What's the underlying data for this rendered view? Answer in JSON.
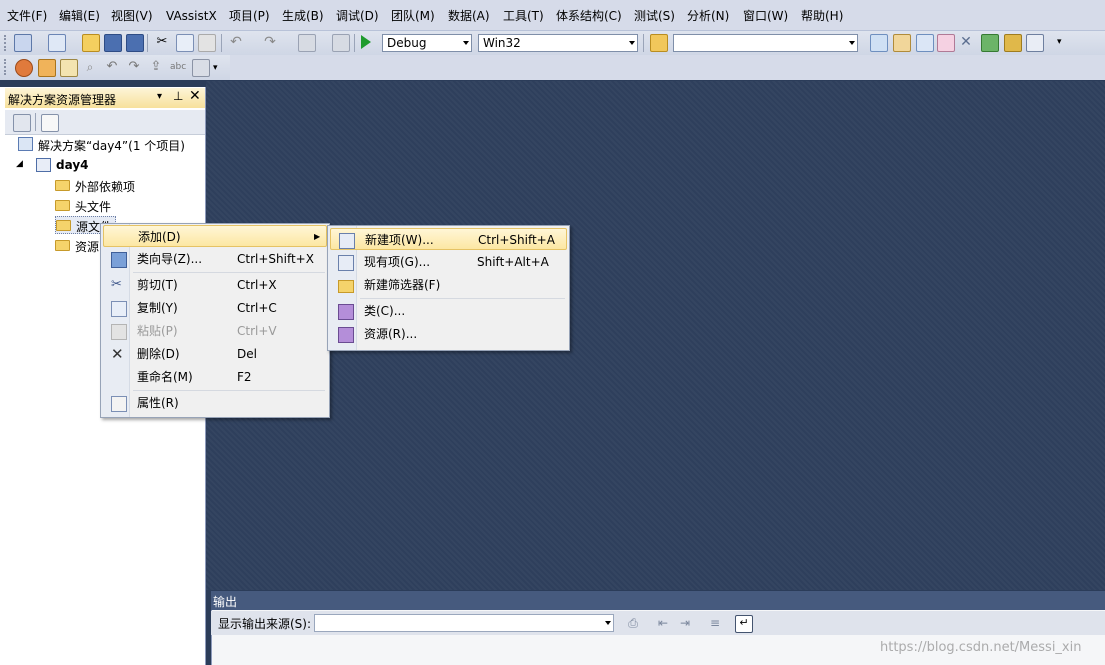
{
  "menubar": {
    "items": [
      "文件(F)",
      "编辑(E)",
      "视图(V)",
      "VAssistX",
      "项目(P)",
      "生成(B)",
      "调试(D)",
      "团队(M)",
      "数据(A)",
      "工具(T)",
      "体系结构(C)",
      "测试(S)",
      "分析(N)",
      "窗口(W)",
      "帮助(H)"
    ]
  },
  "toolbar": {
    "config_value": "Debug",
    "platform_value": "Win32",
    "search_value": ""
  },
  "solution_explorer": {
    "title": "解决方案资源管理器",
    "solution_label": "解决方案“day4”(1 个项目)",
    "project_label": "day4",
    "nodes": [
      "外部依赖项",
      "头文件",
      "源文件",
      "资源"
    ]
  },
  "context_menu": {
    "items": [
      {
        "label": "添加(D)",
        "key": "",
        "icon": "add-submenu"
      },
      {
        "label": "类向导(Z)...",
        "key": "Ctrl+Shift+X",
        "icon": "class-wizard-icon"
      },
      {
        "label": "剪切(T)",
        "key": "Ctrl+X",
        "icon": "scissors-icon"
      },
      {
        "label": "复制(Y)",
        "key": "Ctrl+C",
        "icon": "copy-icon"
      },
      {
        "label": "粘贴(P)",
        "key": "Ctrl+V",
        "icon": "paste-icon"
      },
      {
        "label": "删除(D)",
        "key": "Del",
        "icon": "delete-icon"
      },
      {
        "label": "重命名(M)",
        "key": "F2",
        "icon": ""
      },
      {
        "label": "属性(R)",
        "key": "",
        "icon": "properties-icon"
      }
    ]
  },
  "submenu": {
    "items": [
      {
        "label": "新建项(W)...",
        "key": "Ctrl+Shift+A"
      },
      {
        "label": "现有项(G)...",
        "key": "Shift+Alt+A"
      },
      {
        "label": "新建筛选器(F)",
        "key": ""
      },
      {
        "label": "类(C)...",
        "key": ""
      },
      {
        "label": "资源(R)...",
        "key": ""
      }
    ]
  },
  "output": {
    "title": "输出",
    "source_label": "显示输出来源(S):",
    "source_value": ""
  },
  "watermark": "https://blog.csdn.net/Messi_xin",
  "colors": {
    "accent": "#2b3c59",
    "highlight": "#fce7a3"
  }
}
